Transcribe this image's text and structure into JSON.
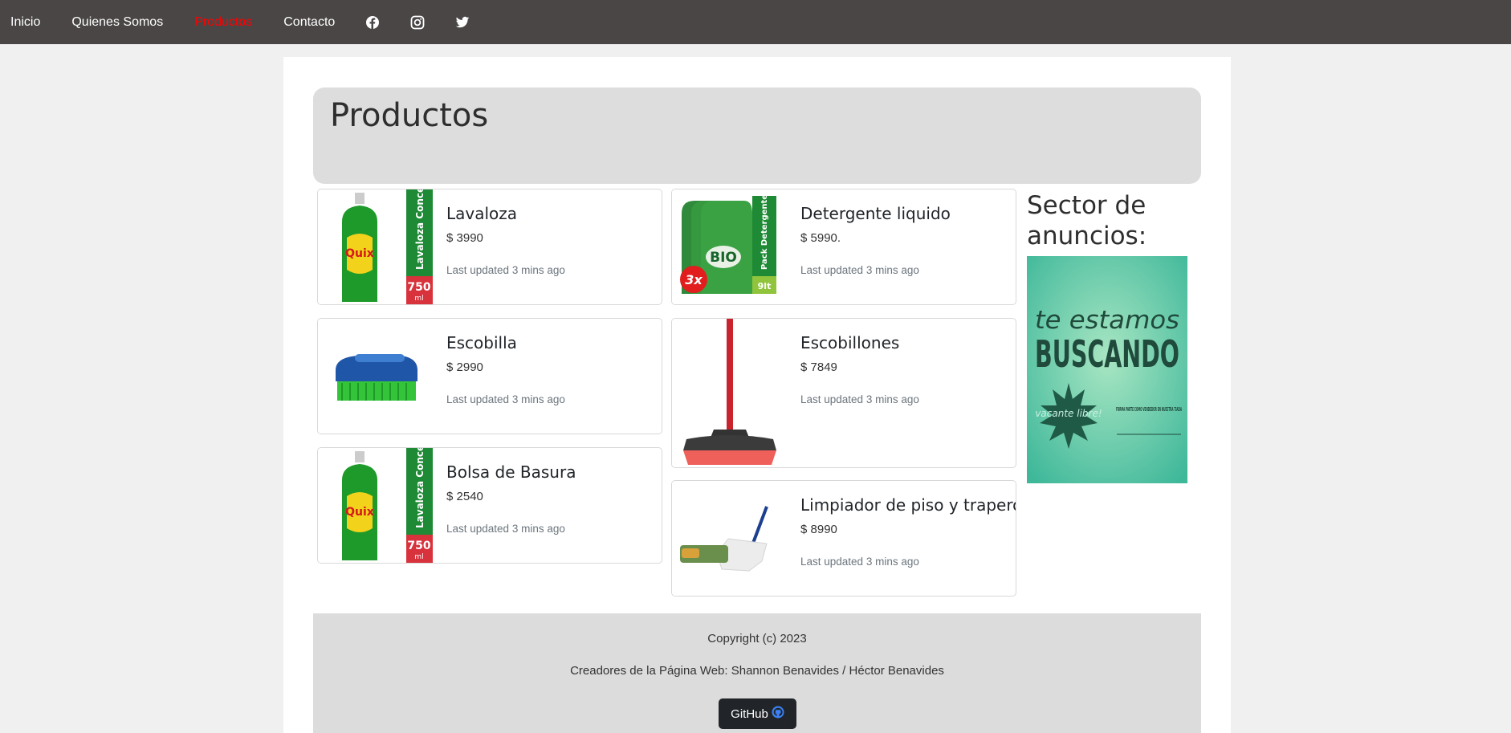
{
  "nav": {
    "items": [
      {
        "label": "Inicio",
        "active": false
      },
      {
        "label": "Quienes Somos",
        "active": false
      },
      {
        "label": "Productos",
        "active": true
      },
      {
        "label": "Contacto",
        "active": false
      }
    ],
    "social_icons": [
      "facebook-icon",
      "instagram-icon",
      "twitter-icon"
    ],
    "active_color": "#ff0000"
  },
  "hero": {
    "title": "Productos"
  },
  "products": [
    {
      "title": "Lavaloza",
      "price": "$ 3990",
      "updated": "Last updated 3 mins ago",
      "image": "lavaloza-bottle",
      "pack_label": "Lavaloza Concentrado",
      "size": "750",
      "unit": "ml",
      "brand": "Quix"
    },
    {
      "title": "Detergente liquido",
      "price": "$ 5990.",
      "updated": "Last updated 3 mins ago",
      "image": "detergent-pack",
      "pack_label": "Pack Detergente Líquido",
      "size": "9lt",
      "badge": "3x",
      "brand": "BIO"
    },
    {
      "title": "Escobilla",
      "price": "$ 2990",
      "updated": "Last updated 3 mins ago",
      "image": "scrub-brush"
    },
    {
      "title": "Escobillones",
      "price": "$ 7849",
      "updated": "Last updated 3 mins ago",
      "image": "broom"
    },
    {
      "title": "Bolsa de Basura",
      "price": "$ 2540",
      "updated": "Last updated 3 mins ago",
      "image": "lavaloza-bottle",
      "pack_label": "Lavaloza Concentrado",
      "size": "750",
      "unit": "ml",
      "brand": "Quix"
    },
    {
      "title": "Limpiador de piso y trapero",
      "price": "$ 8990",
      "updated": "Last updated 3 mins ago",
      "image": "floor-mop"
    }
  ],
  "ads": {
    "title": "Sector de anuncios:",
    "banner": {
      "line1": "te estamos",
      "line2": "BUSCANDO",
      "starburst": "vacante libre!",
      "text": "FORMA PARTE COMO VENDEDOR EN NUESTRA TIADA"
    }
  },
  "footer": {
    "copyright": "Copyright (c) 2023",
    "creators": "Creadores de la Página Web: Shannon Benavides / Héctor Benavides",
    "github_label": "GitHub"
  }
}
